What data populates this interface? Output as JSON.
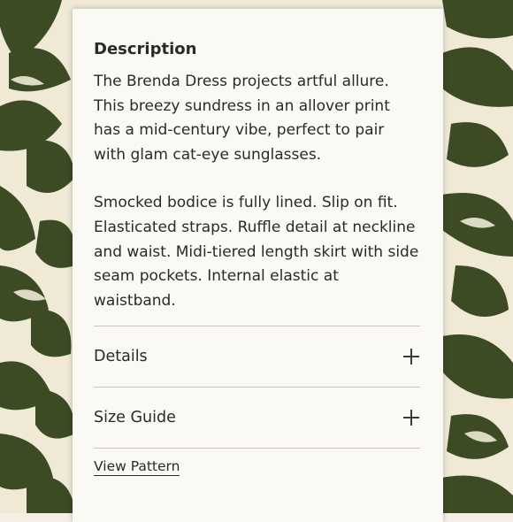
{
  "colors": {
    "leaf_dark": "#3a4a22",
    "leaf_mid": "#4d5c2f",
    "background_cream": "#efe9d6",
    "card": "#fbf9f3",
    "text": "#2a2a2a"
  },
  "description": {
    "heading": "Description",
    "paragraph_1": "The Brenda Dress projects artful allure. This breezy sundress in an allover print has a mid-century vibe, perfect to pair with glam cat-eye sunglasses.",
    "paragraph_2": "Smocked bodice is fully lined. Slip on fit. Elasticated straps. Ruffle detail at neckline and waist. Midi-tiered length skirt with side seam pockets. Internal elastic at waistband."
  },
  "accordions": [
    {
      "label": "Details",
      "icon": "plus-icon"
    },
    {
      "label": "Size Guide",
      "icon": "plus-icon"
    }
  ],
  "link": {
    "label": "View Pattern"
  }
}
